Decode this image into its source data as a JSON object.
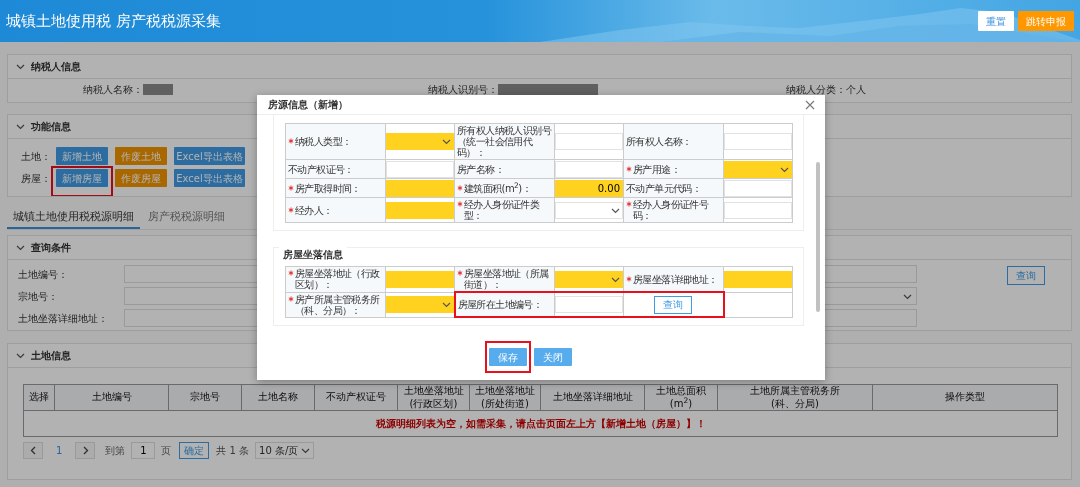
{
  "header": {
    "title": "城镇土地使用税 房产税税源采集",
    "buttons": [
      {
        "label": "重置",
        "kind": "reset"
      },
      {
        "label": "跳转申报",
        "kind": "submit"
      }
    ]
  },
  "taxpayer_panel": {
    "title": "纳税人信息",
    "fields": [
      {
        "label": "纳税人名称：",
        "redacted": true
      },
      {
        "label": "纳税人识别号：",
        "redacted": true
      },
      {
        "label": "纳税人分类：",
        "value": "个人",
        "redacted": false
      }
    ]
  },
  "function_panel": {
    "title": "功能信息",
    "rows": [
      {
        "label": "土地：",
        "buttons": [
          {
            "label": "新增土地",
            "kind": "add",
            "framed": false
          },
          {
            "label": "作废土地",
            "kind": "void",
            "framed": false
          },
          {
            "label": "Excel导出表格",
            "kind": "export",
            "framed": false
          }
        ]
      },
      {
        "label": "房屋：",
        "buttons": [
          {
            "label": "新增房屋",
            "kind": "add",
            "framed": true
          },
          {
            "label": "作废房屋",
            "kind": "void",
            "framed": false
          },
          {
            "label": "Excel导出表格",
            "kind": "export",
            "framed": false
          }
        ]
      }
    ]
  },
  "tabs": [
    {
      "label": "城镇土地使用税税源明细",
      "selected": true
    },
    {
      "label": "房产税税源明细",
      "selected": false
    }
  ],
  "query_panel": {
    "title": "查询条件",
    "fields": [
      {
        "label": "土地编号：",
        "kind": "input"
      },
      {
        "label": "宗地号：",
        "kind": "select"
      },
      {
        "label": "土地坐落详细地址：",
        "kind": "input"
      }
    ],
    "button": "查询"
  },
  "land_panel": {
    "title": "土地信息",
    "table": {
      "columns": [
        "选择",
        "土地编号",
        "宗地号",
        "土地名称",
        "不动产权证号",
        "土地坐落地址\n(行政区划)",
        "土地坐落地址\n(所处街道)",
        "土地坐落详细地址",
        "土地总面积(m$^{2}$)",
        "土地所属主管税务所\n(科、分局)",
        "操作类型"
      ],
      "empty_message": "税源明细列表为空，如需采集，请点击页面左上方【新增土地（房屋）】！"
    },
    "pagination": {
      "current_page": "1",
      "goto_label": "到第",
      "goto_value": "1",
      "page_label": "页",
      "confirm": "确定",
      "total": "共 1 条",
      "page_size": "10 条/页"
    }
  },
  "modal": {
    "title": "房源信息（新增）",
    "property_rows": [
      [
        {
          "kind": "label",
          "text": "纳税人类型：",
          "required": true
        },
        {
          "kind": "select",
          "required": true
        },
        {
          "kind": "label",
          "text": "所有权人纳税人识别号（统一社会信用代码）：",
          "required": false
        },
        {
          "kind": "input",
          "required": false
        },
        {
          "kind": "label",
          "text": "所有权人名称：",
          "required": false
        },
        {
          "kind": "input",
          "required": false
        }
      ],
      [
        {
          "kind": "label",
          "text": "不动产权证号：",
          "required": false
        },
        {
          "kind": "input",
          "required": false
        },
        {
          "kind": "label",
          "text": "房产名称：",
          "required": false
        },
        {
          "kind": "input",
          "required": false
        },
        {
          "kind": "label",
          "text": "房产用途：",
          "required": true
        },
        {
          "kind": "select",
          "required": true
        }
      ],
      [
        {
          "kind": "label",
          "text": "房产取得时间：",
          "required": true
        },
        {
          "kind": "input",
          "required": true
        },
        {
          "kind": "label",
          "text": "建筑面积(m$^{2}$)：",
          "required": true
        },
        {
          "kind": "input",
          "required": true,
          "value": "0.00"
        },
        {
          "kind": "label",
          "text": "不动产单元代码：",
          "required": false
        },
        {
          "kind": "input",
          "required": false
        }
      ],
      [
        {
          "kind": "label",
          "text": "经办人：",
          "required": true
        },
        {
          "kind": "input",
          "required": true
        },
        {
          "kind": "label",
          "text": "经办人身份证件类型：",
          "required": true
        },
        {
          "kind": "select",
          "required": false
        },
        {
          "kind": "label",
          "text": "经办人身份证件号码：",
          "required": true
        },
        {
          "kind": "input",
          "required": false
        }
      ]
    ],
    "location_section": {
      "title": "房屋坐落信息",
      "rows": [
        [
          {
            "kind": "label",
            "text": "房屋坐落地址（行政区划）：",
            "required": true,
            "framed": false
          },
          {
            "kind": "input",
            "required": true,
            "framed": false
          },
          {
            "kind": "label",
            "text": "房屋坐落地址（所属街道）：",
            "required": true,
            "framed": false
          },
          {
            "kind": "select",
            "required": true,
            "framed": false
          },
          {
            "kind": "label",
            "text": "房屋坐落详细地址：",
            "required": true,
            "framed": false
          },
          {
            "kind": "input",
            "required": true,
            "framed": false
          }
        ],
        [
          {
            "kind": "label",
            "text": "房产所属主管税务所（科、分局）：",
            "required": true,
            "framed": false
          },
          {
            "kind": "select",
            "required": true,
            "framed": false
          },
          {
            "kind": "label",
            "text": "房屋所在土地编号：",
            "required": false,
            "framed": true
          },
          {
            "kind": "input",
            "required": false,
            "framed": true
          },
          {
            "kind": "button",
            "text": "查询",
            "framed": true
          },
          {
            "kind": "empty",
            "framed": false
          }
        ]
      ]
    },
    "buttons": [
      {
        "label": "保存",
        "framed": true
      },
      {
        "label": "关闭",
        "framed": false
      }
    ]
  }
}
